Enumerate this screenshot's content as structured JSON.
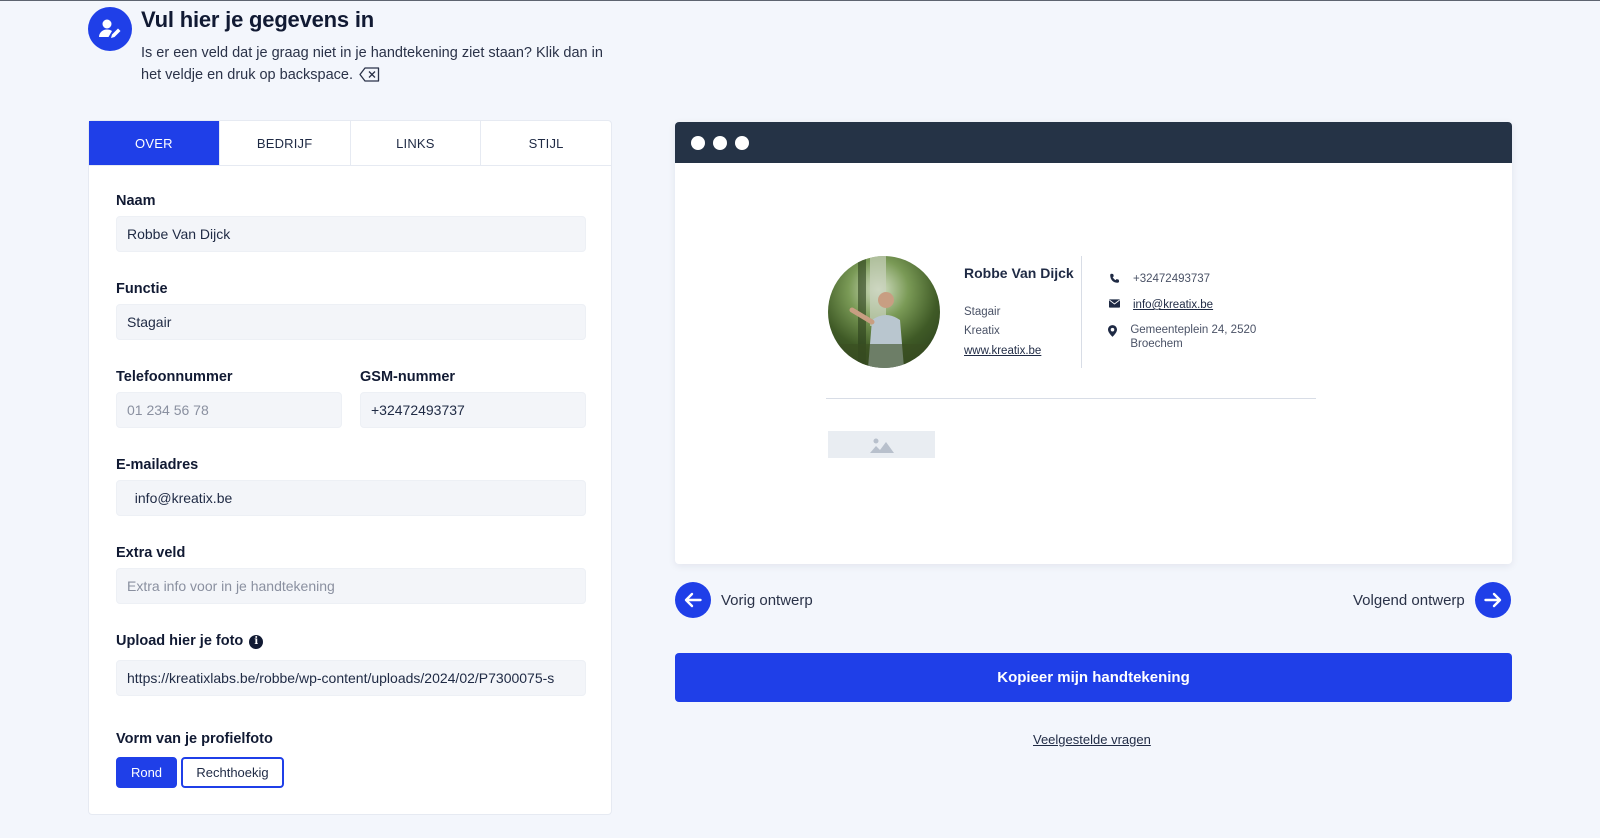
{
  "header": {
    "title": "Vul hier je gegevens in",
    "description": "Is er een veld dat je graag niet in je handtekening ziet staan? Klik dan in het veldje en druk op backspace."
  },
  "tabs": [
    {
      "label": "OVER",
      "active": true
    },
    {
      "label": "BEDRIJF",
      "active": false
    },
    {
      "label": "LINKS",
      "active": false
    },
    {
      "label": "STIJL",
      "active": false
    }
  ],
  "form": {
    "name": {
      "label": "Naam",
      "value": "Robbe Van Dijck",
      "placeholder": ""
    },
    "function": {
      "label": "Functie",
      "value": "Stagair",
      "placeholder": ""
    },
    "phone": {
      "label": "Telefoonnummer",
      "value": "",
      "placeholder": "01 234 56 78"
    },
    "mobile": {
      "label": "GSM-nummer",
      "value": "+32472493737",
      "placeholder": ""
    },
    "email": {
      "label": "E-mailadres",
      "value": "  info@kreatix.be",
      "placeholder": ""
    },
    "extra": {
      "label": "Extra veld",
      "value": "",
      "placeholder": "Extra info voor in je handtekening"
    },
    "photo": {
      "label": "Upload hier je foto",
      "value": "https://kreatixlabs.be/robbe/wp-content/uploads/2024/02/P7300075-s",
      "placeholder": ""
    },
    "shape": {
      "label": "Vorm van je profielfoto",
      "options": [
        "Rond",
        "Rechthoekig"
      ],
      "selected": "Rond"
    }
  },
  "signature": {
    "name": "Robbe Van Dijck",
    "role": "Stagair",
    "company": "Kreatix",
    "website": "www.kreatix.be",
    "phone": "+32472493737",
    "email": "info@kreatix.be",
    "address": "Gemeenteplein 24, 2520 Broechem"
  },
  "nav": {
    "prev": "Vorig ontwerp",
    "next": "Volgend ontwerp"
  },
  "copy_button": "Kopieer mijn handtekening",
  "faq_link": "Veelgestelde vragen",
  "colors": {
    "accent": "#1f3fe8",
    "preview_bar": "#253346",
    "background": "#f3f6fc"
  },
  "icons": {
    "header": "user-edit-icon",
    "backspace": "backspace-icon",
    "info": "info-icon",
    "phone": "phone-icon",
    "email": "envelope-icon",
    "address": "location-pin-icon",
    "banner": "image-placeholder-icon",
    "prev": "arrow-left-icon",
    "next": "arrow-right-icon"
  }
}
